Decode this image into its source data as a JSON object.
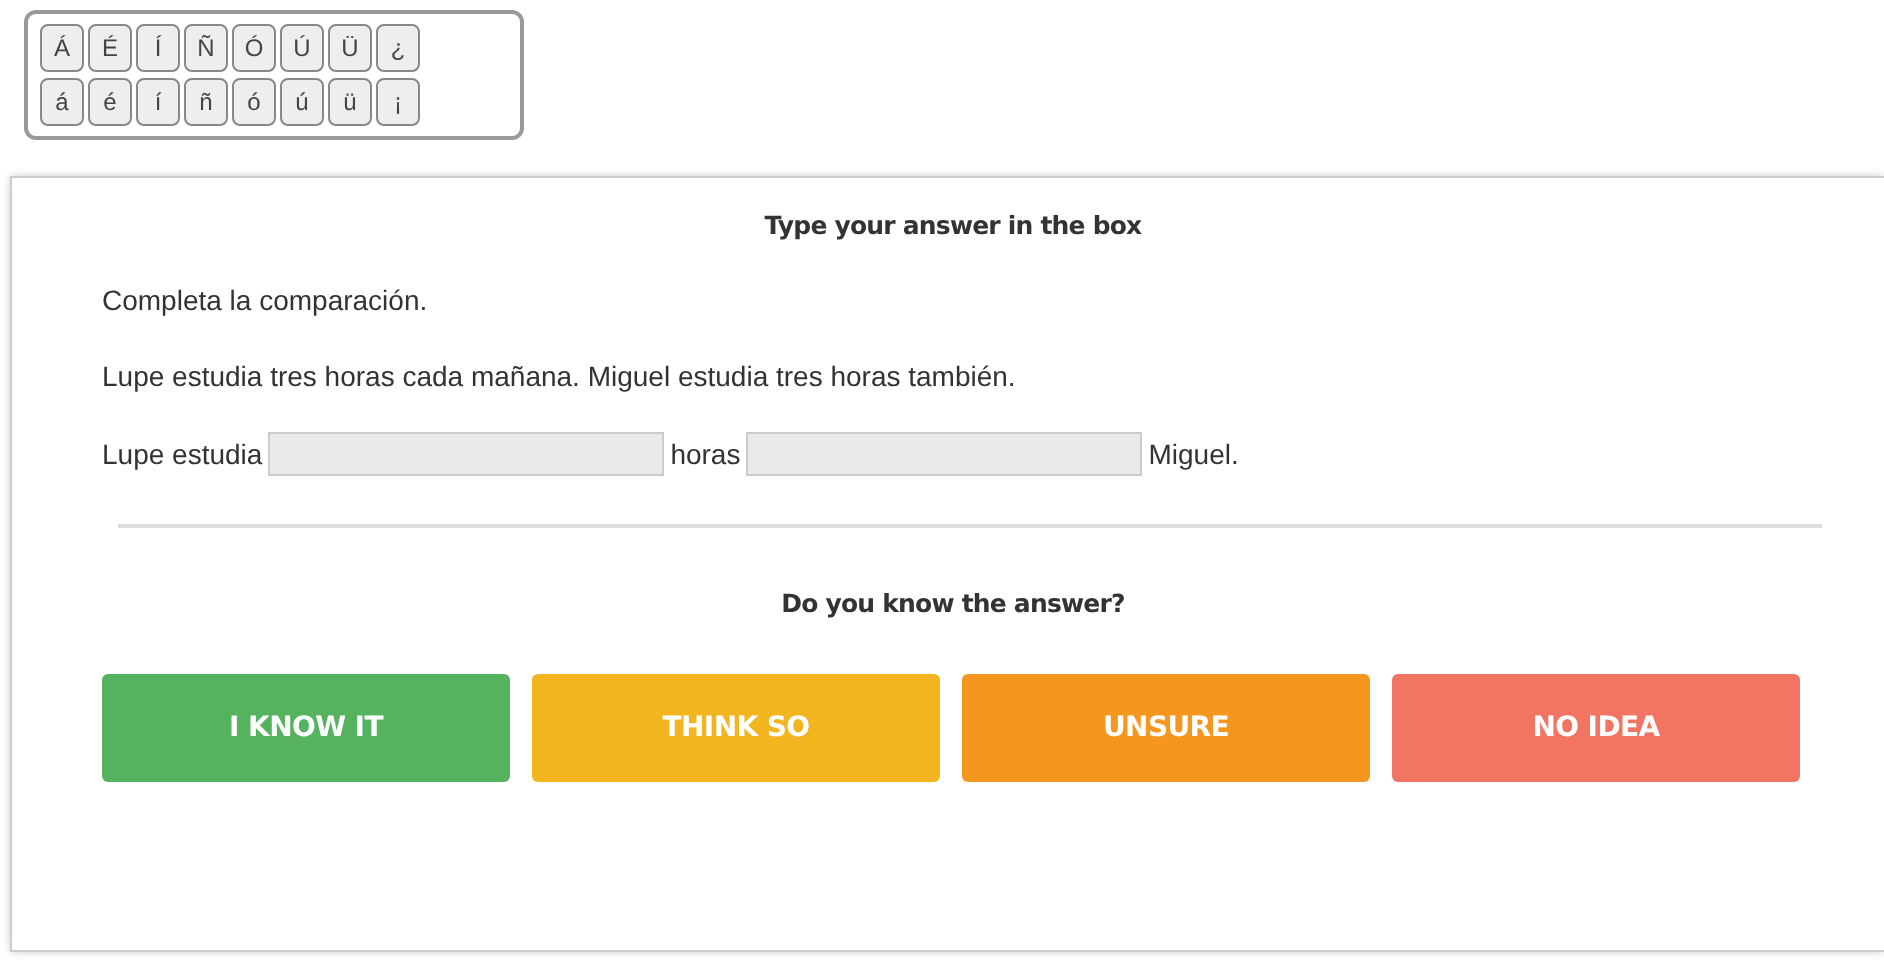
{
  "keypad": {
    "rows": [
      [
        "Á",
        "É",
        "Í",
        "Ñ",
        "Ó",
        "Ú",
        "Ü",
        "¿"
      ],
      [
        "á",
        "é",
        "í",
        "ñ",
        "ó",
        "ú",
        "ü",
        "¡"
      ]
    ]
  },
  "card": {
    "heading": "Type your answer in the box",
    "instruction": "Completa la comparación.",
    "prompt": "Lupe estudia tres horas cada mañana. Miguel estudia tres horas también.",
    "sentence": [
      {
        "kind": "text",
        "text": "Lupe estudia"
      },
      {
        "kind": "blank"
      },
      {
        "kind": "text",
        "text": "horas"
      },
      {
        "kind": "blank"
      },
      {
        "kind": "text",
        "text": "Miguel."
      }
    ],
    "question": "Do you know the answer?",
    "buttons": [
      {
        "label": "I KNOW IT",
        "color": "#55b25f"
      },
      {
        "label": "THINK SO",
        "color": "#f2b51f"
      },
      {
        "label": "UNSURE",
        "color": "#f5971f"
      },
      {
        "label": "NO IDEA",
        "color": "#f17562"
      }
    ]
  }
}
